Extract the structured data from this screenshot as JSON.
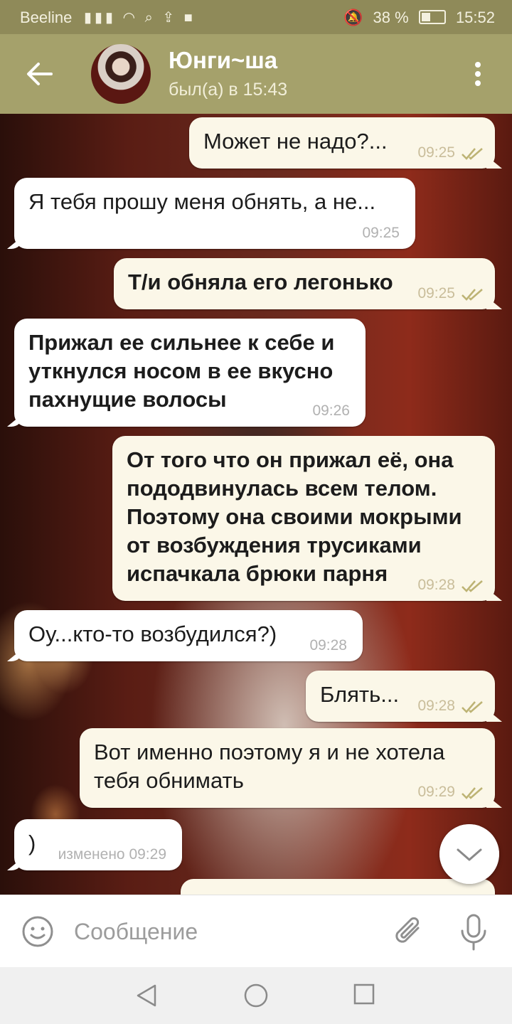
{
  "status_bar": {
    "carrier": "Beeline",
    "battery": "38 %",
    "time": "15:52"
  },
  "header": {
    "name": "Юнги~ша",
    "status": "был(а) в 15:43"
  },
  "messages": [
    {
      "dir": "out",
      "text": "Может не надо?...",
      "time": "09:25",
      "read": true
    },
    {
      "dir": "in",
      "text": "Я тебя прошу меня обнять, а не...",
      "time": "09:25"
    },
    {
      "dir": "out",
      "text": "Т/и обняла его легонько",
      "time": "09:25",
      "read": true
    },
    {
      "dir": "in",
      "text": "Прижал ее сильнее к себе и\nуткнулся носом в ее вкусно\nпахнущие волосы",
      "time": "09:26"
    },
    {
      "dir": "out",
      "text": "От того что он прижал её, она\nпододвинулась всем телом.\nПоэтому она своими мокрыми\nот возбуждения трусиками\nиспачкала брюки парня",
      "time": "09:28",
      "read": true
    },
    {
      "dir": "in",
      "text": "Оу...кто-то возбудился?)",
      "time": "09:28"
    },
    {
      "dir": "out",
      "text": "Блять...",
      "time": "09:28",
      "read": true
    },
    {
      "dir": "out",
      "text": "Вот именно поэтому я и не хотела\nтебя обнимать",
      "time": "09:29",
      "read": true
    },
    {
      "dir": "in",
      "text": ")",
      "time": "изменено 09:29"
    }
  ],
  "composer": {
    "placeholder": "Сообщение"
  },
  "colors": {
    "header": "#a5a16b",
    "status_bar": "#8f8a59",
    "incoming_bubble": "#ffffff",
    "outgoing_bubble": "#fbf7e8",
    "read_check": "#bdb374"
  }
}
